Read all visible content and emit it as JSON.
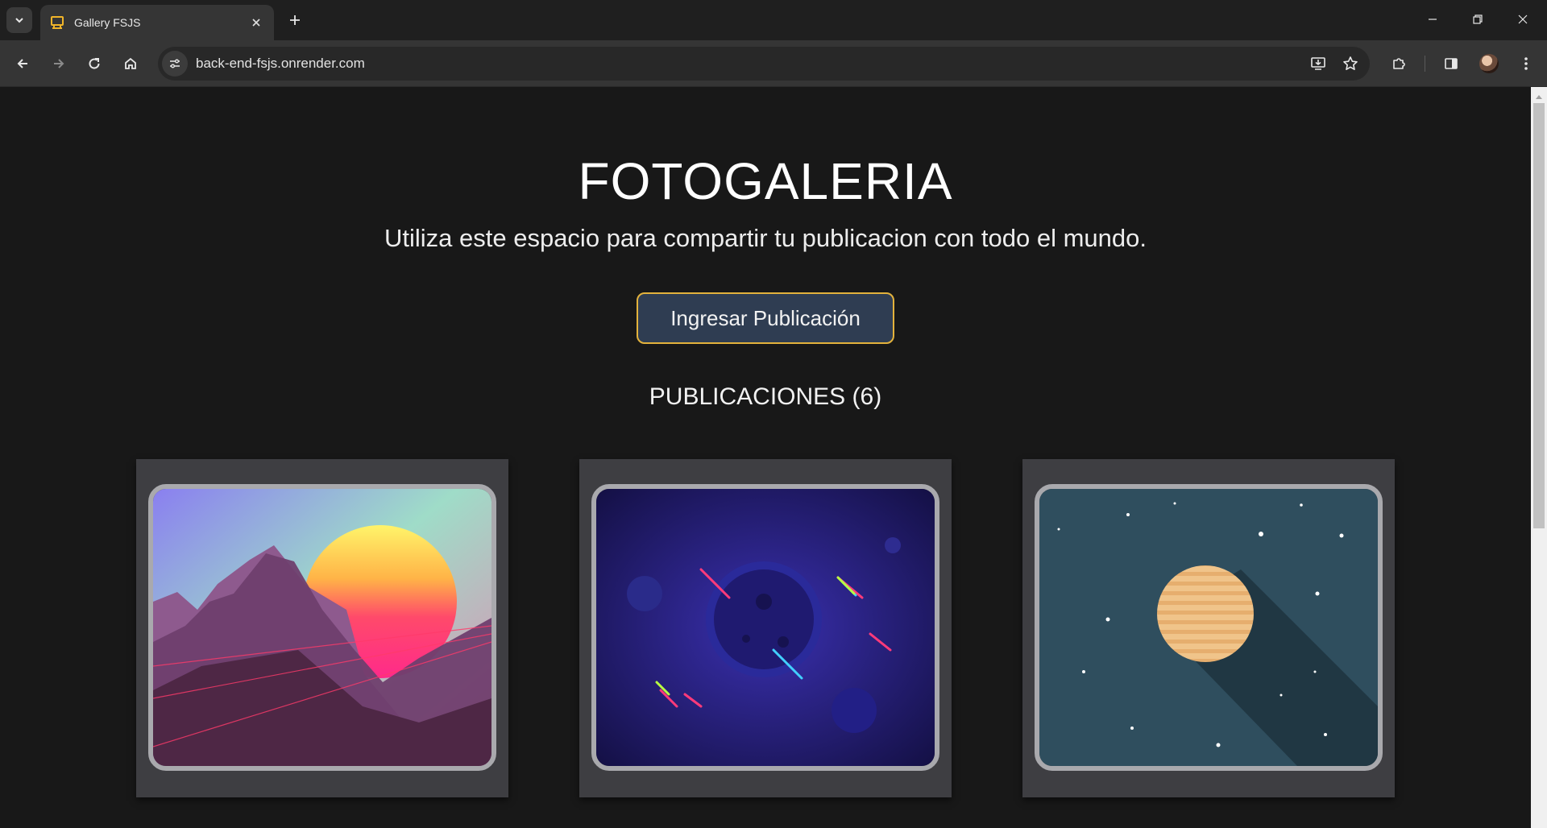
{
  "browser": {
    "tab_title": "Gallery FSJS",
    "url": "back-end-fsjs.onrender.com"
  },
  "page": {
    "title": "FOTOGALERIA",
    "subtitle": "Utiliza este espacio para compartir tu publicacion con todo el mundo.",
    "cta_label": "Ingresar Publicación",
    "section_title": "PUBLICACIONES (6)"
  },
  "icons": {
    "tab_list": "chevron-down-icon",
    "favicon": "gallery-favicon-icon",
    "back": "arrow-left-icon",
    "forward": "arrow-right-icon",
    "reload": "reload-icon",
    "home": "home-icon",
    "site_info": "tune-icon",
    "install": "install-app-icon",
    "bookmark": "star-icon",
    "extensions": "puzzle-icon",
    "side_panel": "side-panel-icon",
    "menu": "kebab-menu-icon"
  },
  "colors": {
    "page_bg": "#181818",
    "card_bg": "#3e3e42",
    "cta_bg": "#2f3d52",
    "cta_border": "#e3b23c"
  }
}
